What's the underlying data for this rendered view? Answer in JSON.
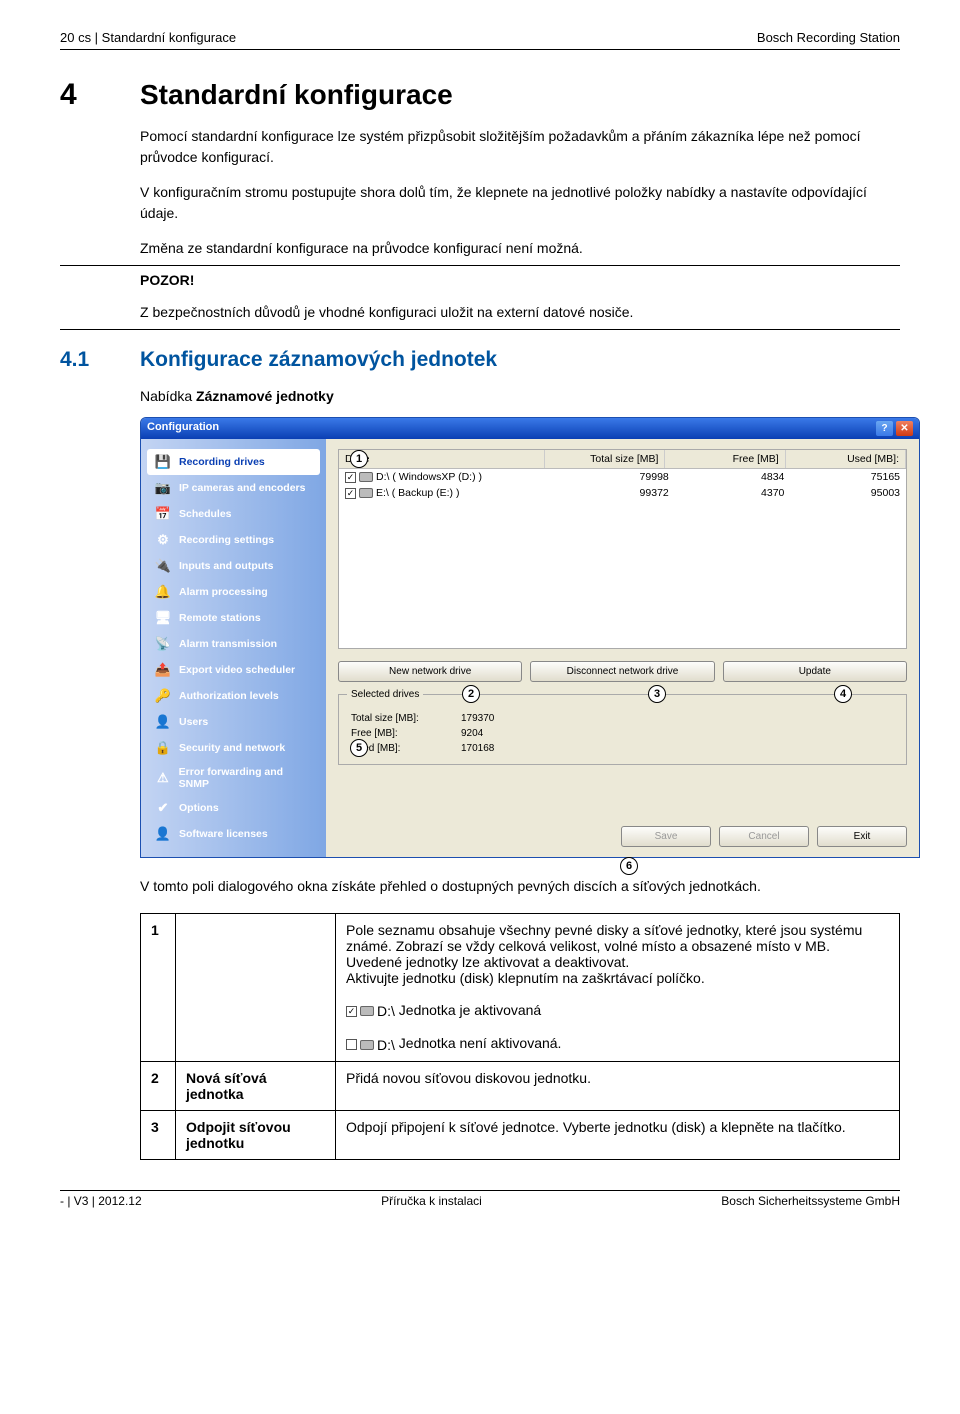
{
  "header": {
    "left": "20    cs | Standardní konfigurace",
    "right": "Bosch Recording Station"
  },
  "section": {
    "num": "4",
    "title": "Standardní konfigurace"
  },
  "para1": "Pomocí standardní konfigurace lze systém přizpůsobit složitějším požadavkům a přáním zákazníka lépe než pomocí průvodce konfigurací.",
  "para2": "V konfiguračním stromu postupujte shora dolů tím, že klepnete na jednotlivé položky nabídky a nastavíte odpovídající údaje.",
  "para3": "Změna ze standardní konfigurace na průvodce konfigurací není možná.",
  "pozor": "POZOR!",
  "pozor_text": "Z bezpečnostních důvodů je vhodné konfiguraci uložit na externí datové nosiče.",
  "sub": {
    "num": "4.1",
    "title": "Konfigurace záznamových jednotek"
  },
  "sub_intro": "Nabídka Záznamové jednotky",
  "win": {
    "title": "Configuration",
    "sidebar": [
      "Recording drives",
      "IP cameras and encoders",
      "Schedules",
      "Recording settings",
      "Inputs and outputs",
      "Alarm processing",
      "Remote stations",
      "Alarm transmission",
      "Export video scheduler",
      "Authorization levels",
      "Users",
      "Security and network",
      "Error forwarding and SNMP",
      "Options",
      "Software licenses"
    ],
    "sidebar_icons": [
      "💾",
      "📷",
      "📅",
      "⚙",
      "🔌",
      "🔔",
      "🖥",
      "📡",
      "📤",
      "🔑",
      "👤",
      "🔒",
      "⚠",
      "✔",
      "👤"
    ],
    "drive_headers": {
      "drive": "Drive",
      "total": "Total size [MB]",
      "free": "Free [MB]",
      "used": "Used [MB]:"
    },
    "drives": [
      {
        "name": "D:\\ ( WindowsXP (D:) )",
        "total": "79998",
        "free": "4834",
        "used": "75165"
      },
      {
        "name": "E:\\ ( Backup (E:) )",
        "total": "99372",
        "free": "4370",
        "used": "95003"
      }
    ],
    "buttons": {
      "new": "New network drive",
      "disc": "Disconnect network drive",
      "upd": "Update"
    },
    "selected": {
      "title": "Selected drives",
      "r1l": "Total size [MB]:",
      "r1v": "179370",
      "r2l": "Free [MB]:",
      "r2v": "9204",
      "r3l": "Used [MB]:",
      "r3v": "170168"
    },
    "bottom": {
      "save": "Save",
      "cancel": "Cancel",
      "exit": "Exit"
    }
  },
  "after_screenshot": "V tomto poli dialogového okna získáte přehled o dostupných pevných discích a síťových jednotkách.",
  "table": {
    "r1": {
      "n": "1",
      "label": "",
      "d1": "Pole seznamu obsahuje všechny pevné disky a síťové jednotky, které jsou systému známé. Zobrazí se vždy celková velikost, volné místo a obsazené místo v MB.",
      "d2": "Uvedené jednotky lze aktivovat a deaktivovat.",
      "d3": "Aktivujte jednotku (disk) klepnutím na zaškrtávací políčko.",
      "d4_label": "D:\\",
      "d4_text": " Jednotka je aktivovaná",
      "d5_label": "D:\\",
      "d5_text": " Jednotka není aktivovaná."
    },
    "r2": {
      "n": "2",
      "label": "Nová síťová jednotka",
      "d": "Přidá novou síťovou diskovou jednotku."
    },
    "r3": {
      "n": "3",
      "label": "Odpojit síťovou jednotku",
      "d": "Odpojí připojení k síťové jednotce. Vyberte jednotku (disk) a klepněte na tlačítko."
    }
  },
  "footer": {
    "left": "- | V3 | 2012.12",
    "mid": "Příručka k instalaci",
    "right": "Bosch Sicherheitssysteme GmbH"
  }
}
